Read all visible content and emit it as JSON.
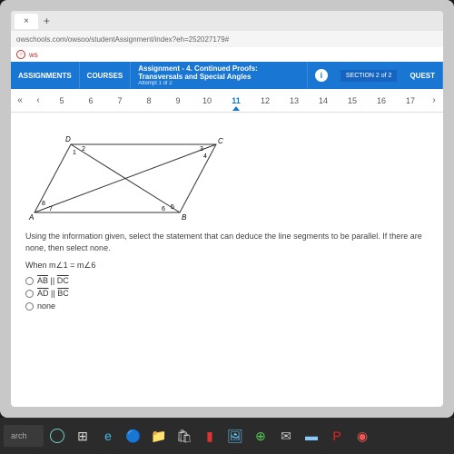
{
  "browser": {
    "tab_close": "×",
    "tab_plus": "+",
    "url": "owschools.com/owsoo/studentAssignment/index?eh=252027179#",
    "app_name": "ws"
  },
  "header": {
    "assignments": "ASSIGNMENTS",
    "courses": "COURSES",
    "assignment_label": "Assignment",
    "assignment_title": "- 4. Continued Proofs: Transversals and Special Angles",
    "attempt": "Attempt 1 of 2",
    "section": "SECTION 2 of 2",
    "quest": "QUEST"
  },
  "pager": {
    "dleft": "«",
    "left": "‹",
    "nums": [
      "5",
      "6",
      "7",
      "8",
      "9",
      "10",
      "11",
      "12",
      "13",
      "14",
      "15",
      "16",
      "17"
    ],
    "active": "11",
    "right": "›"
  },
  "figure": {
    "A": "A",
    "B": "B",
    "C": "C",
    "D": "D",
    "a1": "1",
    "a2": "2",
    "a3": "3",
    "a4": "4",
    "a5": "5",
    "a6": "6",
    "a7": "7",
    "a8": "8"
  },
  "question": {
    "text": "Using the information given, select the statement that can deduce the line segments to be parallel. If there are none, then select none.",
    "when": "When m∠1 = m∠6",
    "optA_1": "AB",
    "optA_mid": " || ",
    "optA_2": "DC",
    "optB_1": "AD",
    "optB_mid": " || ",
    "optB_2": "BC",
    "optC": "none"
  },
  "taskbar": {
    "search": "arch"
  }
}
